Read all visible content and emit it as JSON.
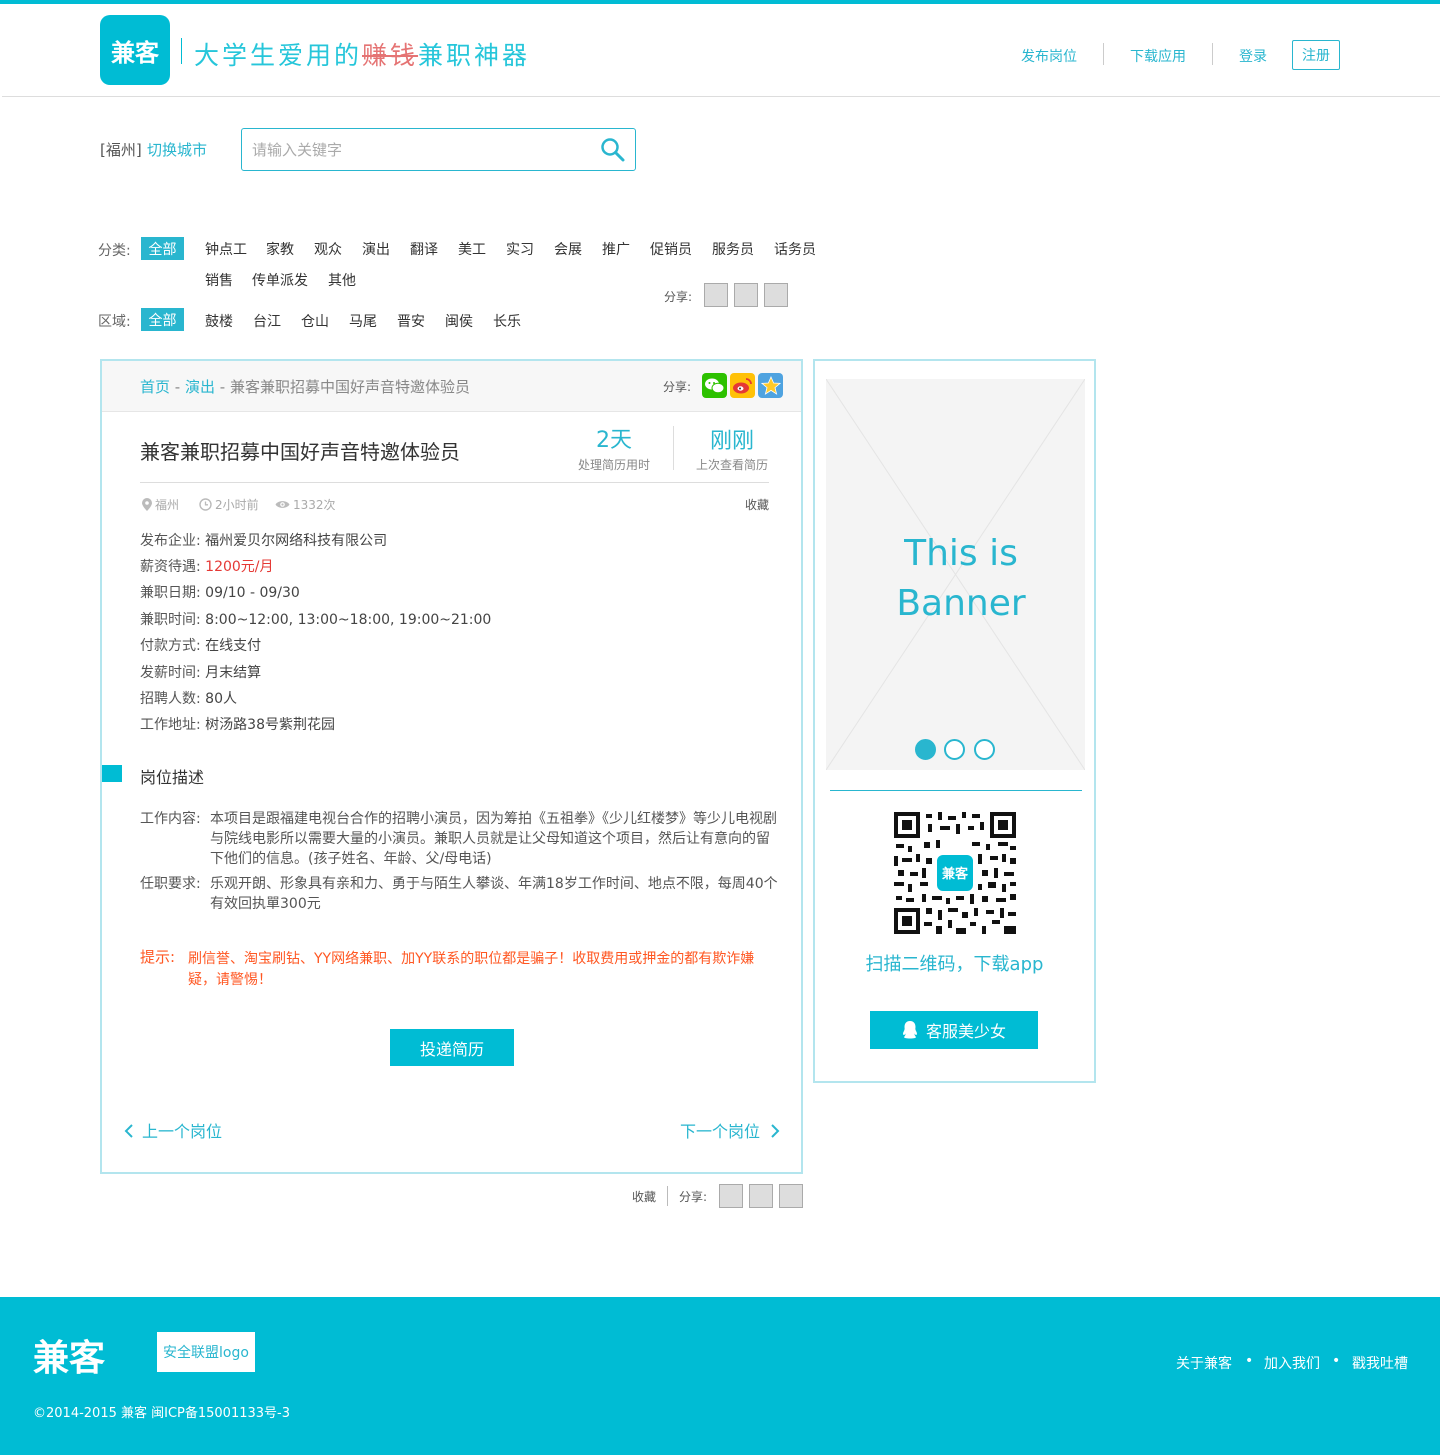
{
  "header": {
    "logo_text": "兼客",
    "slogan_before": "大学生爱用的",
    "slogan_strike": "赚钱",
    "slogan_after": "兼职神器",
    "nav": [
      "发布岗位",
      "下载应用",
      "登录"
    ],
    "register": "注册"
  },
  "search": {
    "city": "[福州]",
    "switch_city": "切换城市",
    "placeholder": "请输入关键字"
  },
  "filters": {
    "category_label": "分类:",
    "category_all": "全部",
    "categories": [
      "钟点工",
      "家教",
      "观众",
      "演出",
      "翻译",
      "美工",
      "实习",
      "会展",
      "推广",
      "促销员",
      "服务员",
      "话务员",
      "销售",
      "传单派发",
      "其他"
    ],
    "share_label": "分享:",
    "region_label": "区域:",
    "region_all": "全部",
    "regions": [
      "鼓楼",
      "台江",
      "仓山",
      "马尾",
      "晋安",
      "闽侯",
      "长乐"
    ]
  },
  "job": {
    "breadcrumb": [
      "首页",
      "演出",
      "兼客兼职招募中国好声音特邀体验员"
    ],
    "share_label": "分享:",
    "title": "兼客兼职招募中国好声音特邀体验员",
    "stats": [
      {
        "value": "2天",
        "caption": "处理简历用时"
      },
      {
        "value": "刚刚",
        "caption": "上次查看简历"
      }
    ],
    "meta": {
      "location": "福州",
      "time": "2小时前",
      "views": "1332次"
    },
    "collect": "收藏",
    "info": [
      {
        "k": "发布企业:",
        "v": "福州爱贝尔网络科技有限公司"
      },
      {
        "k": "薪资待遇:",
        "v": "1200元/月"
      },
      {
        "k": "兼职日期:",
        "v": "09/10 - 09/30"
      },
      {
        "k": "兼职时间:",
        "v": "8:00~12:00, 13:00~18:00, 19:00~21:00"
      },
      {
        "k": "付款方式:",
        "v": "在线支付"
      },
      {
        "k": "发薪时间:",
        "v": "月末结算"
      },
      {
        "k": "招聘人数:",
        "v": "80人"
      },
      {
        "k": "工作地址:",
        "v": "树汤路38号紫荆花园"
      }
    ],
    "desc_heading": "岗位描述",
    "work_content_label": "工作内容:",
    "work_content": "本项目是跟福建电视台合作的招聘小演员，因为筹拍《五祖拳》《少儿红楼梦》等少儿电视剧与院线电影所以需要大量的小演员。兼职人员就是让父母知道这个项目，然后让有意向的留下他们的信息。(孩子姓名、年龄、父/母电话)",
    "requirement_label": "任职要求:",
    "requirement": "乐观开朗、形象具有亲和力、勇于与陌生人攀谈、年满18岁工作时间、地点不限，每周40个有效回执單300元",
    "tip_label": "提示:",
    "tip": "刷信誉、淘宝刷钻、YY网络兼职、加YY联系的职位都是骗子！收取费用或押金的都有欺诈嫌疑，请警惕！",
    "apply": "投递简历",
    "prev": "上一个岗位",
    "next": "下一个岗位"
  },
  "bottom_bar": {
    "collect": "收藏",
    "share_label": "分享:"
  },
  "sidebar": {
    "banner_line1": "This is",
    "banner_line2": "Banner",
    "qr_center": "兼客",
    "qr_caption": "扫描二维码，下载app",
    "cs_button": "客服美少女"
  },
  "footer": {
    "logo": "兼客",
    "safety_logo": "安全联盟logo",
    "links": [
      "关于兼客",
      "加入我们",
      "戳我吐槽"
    ],
    "copyright": "©2014-2015 兼客 闽ICP备15001133号-3"
  },
  "colors": {
    "accent": "#00bcd4",
    "link": "#29b6cf",
    "salary": "#e53935",
    "tip": "#ff5722"
  }
}
